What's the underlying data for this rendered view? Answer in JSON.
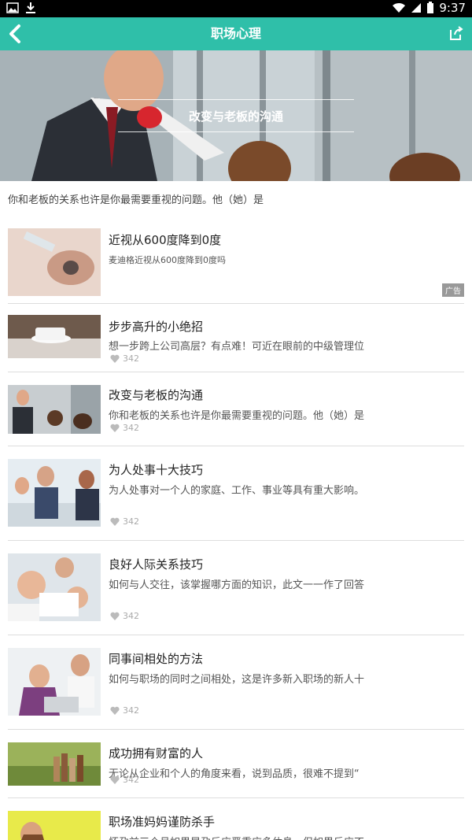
{
  "status": {
    "time": "9:37"
  },
  "header": {
    "title": "职场心理"
  },
  "banner": {
    "caption": "改变与老板的沟通"
  },
  "intro": "你和老板的关系也许是你最需要重视的问题。他（她）是",
  "ad": {
    "title": "近视从600度降到0度",
    "desc": "麦迪格近视从600度降到0度吗",
    "badge": "广告"
  },
  "articles": [
    {
      "title": "步步高升的小绝招",
      "desc": "想一步跨上公司高层？有点难！可近在眼前的中级管理位",
      "likes": "342"
    },
    {
      "title": "改变与老板的沟通",
      "desc": "你和老板的关系也许是你最需要重视的问题。他（她）是",
      "likes": "342"
    },
    {
      "title": "为人处事十大技巧",
      "desc": "为人处事对一个人的家庭、工作、事业等具有重大影响。",
      "likes": "342"
    },
    {
      "title": "良好人际关系技巧",
      "desc": "如何与人交往，该掌握哪方面的知识，此文一一作了回答",
      "likes": "342"
    },
    {
      "title": "同事间相处的方法",
      "desc": "如何与职场的同时之间相处，这是许多新入职场的新人十",
      "likes": "342"
    },
    {
      "title": "成功拥有财富的人",
      "desc": "无论从企业和个人的角度来看，说到品质，很难不提到“",
      "likes": "342"
    },
    {
      "title": "职场准妈妈谨防杀手",
      "desc": "怀孕前三个月如果早孕反应严重应多休息，但如果反应不",
      "likes": ""
    }
  ],
  "colors": {
    "accent": "#2fbfa9"
  }
}
